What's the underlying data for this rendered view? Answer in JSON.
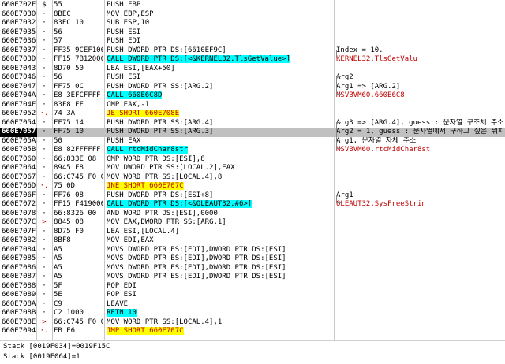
{
  "rows": [
    {
      "addr": "660E702F",
      "arrow": "$",
      "bytes": "55",
      "instr": "PUSH EBP",
      "hl": "",
      "comment": "",
      "ctype": ""
    },
    {
      "addr": "660E7030",
      "arrow": "·",
      "bytes": "8BEC",
      "instr": "MOV EBP,ESP",
      "hl": "",
      "comment": "",
      "ctype": ""
    },
    {
      "addr": "660E7032",
      "arrow": "·",
      "bytes": "83EC 10",
      "instr": "SUB ESP,10",
      "hl": "",
      "comment": "",
      "ctype": ""
    },
    {
      "addr": "660E7035",
      "arrow": "·",
      "bytes": "56",
      "instr": "PUSH ESI",
      "hl": "",
      "comment": "",
      "ctype": ""
    },
    {
      "addr": "660E7036",
      "arrow": "·",
      "bytes": "57",
      "instr": "PUSH EDI",
      "hl": "",
      "comment": "",
      "ctype": ""
    },
    {
      "addr": "660E7037",
      "arrow": "·",
      "bytes": "FF35 9CEF1066",
      "instr": "PUSH DWORD PTR DS:[6610EF9C]",
      "hl": "",
      "comment": "Index = 10.",
      "ctype": "sub"
    },
    {
      "addr": "660E703D",
      "arrow": "·",
      "bytes": "FF15 7B120066",
      "instr": "CALL DWORD PTR DS:[<&KERNEL32.TlsGetValue>]",
      "hl": "cyan",
      "comment": "KERNEL32.TlsGetValu",
      "ctype": "red"
    },
    {
      "addr": "660E7043",
      "arrow": "·",
      "bytes": "8D70 50",
      "instr": "LEA ESI,[EAX+50]",
      "hl": "",
      "comment": "",
      "ctype": ""
    },
    {
      "addr": "660E7046",
      "arrow": "·",
      "bytes": "56",
      "instr": "PUSH ESI",
      "hl": "",
      "comment": "Arg2",
      "ctype": "sub"
    },
    {
      "addr": "660E7047",
      "arrow": "·",
      "bytes": "FF75 0C",
      "instr": "PUSH DWORD PTR SS:[ARG.2]",
      "hl": "",
      "comment": "Arg1 => [ARG.2]",
      "ctype": "sub"
    },
    {
      "addr": "660E704A",
      "arrow": "·",
      "bytes": "E8 3EFCFFFF",
      "instr": "CALL 660E6C8D",
      "hl": "cyan",
      "comment": "MSVBVM60.660E6C8",
      "ctype": "red"
    },
    {
      "addr": "660E704F",
      "arrow": "·",
      "bytes": "83F8 FF",
      "instr": "CMP EAX,-1",
      "hl": "",
      "comment": "",
      "ctype": ""
    },
    {
      "addr": "660E7052",
      "arrow": "·.",
      "bytes": "74 3A",
      "instr": "JE SHORT 660E708E",
      "hl": "yellow",
      "comment": "",
      "ctype": ""
    },
    {
      "addr": "660E7054",
      "arrow": "·",
      "bytes": "FF75 14",
      "instr": "PUSH DWORD PTR SS:[ARG.4]",
      "hl": "",
      "comment": "Arg3 => [ARG.4], guess : 문자열 구조체 주소",
      "ctype": "sub"
    },
    {
      "addr": "660E7057",
      "arrow": "·",
      "bytes": "FF75 10",
      "instr": "PUSH DWORD PTR SS:[ARG.3]",
      "hl": "",
      "comment": "Arg2 = 1, guess : 문자열에서 구하고 싶은 위치",
      "ctype": "sub"
    },
    {
      "addr": "660E705A",
      "arrow": "·",
      "bytes": "50",
      "instr": "PUSH EAX",
      "hl": "",
      "comment": "Arg1, 문자열 자체 주소",
      "ctype": "sub"
    },
    {
      "addr": "660E705B",
      "arrow": "·",
      "bytes": "E8 82FFFFFF",
      "instr": "CALL rtcMidChar8str",
      "hl": "cyan",
      "comment": "MSVBVM60.rtcMidChar8st",
      "ctype": "red"
    },
    {
      "addr": "660E7060",
      "arrow": "·",
      "bytes": "66:833E 08",
      "instr": "CMP WORD PTR DS:[ESI],8",
      "hl": "",
      "comment": "",
      "ctype": ""
    },
    {
      "addr": "660E7064",
      "arrow": "·",
      "bytes": "8945 F8",
      "instr": "MOV DWORD PTR SS:[LOCAL.2],EAX",
      "hl": "",
      "comment": "",
      "ctype": ""
    },
    {
      "addr": "660E7067",
      "arrow": "·",
      "bytes": "66:C745 F0 08",
      "instr": "MOV WORD PTR SS:[LOCAL.4],8",
      "hl": "",
      "comment": "",
      "ctype": ""
    },
    {
      "addr": "660E706D",
      "arrow": "·.",
      "bytes": "75 0D",
      "instr": "JNE SHORT 660E707C",
      "hl": "yellow",
      "comment": "",
      "ctype": ""
    },
    {
      "addr": "660E706F",
      "arrow": "·",
      "bytes": "FF76 08",
      "instr": "PUSH DWORD PTR DS:[ESI+8]",
      "hl": "",
      "comment": "Arg1",
      "ctype": "sub"
    },
    {
      "addr": "660E7072",
      "arrow": "·",
      "bytes": "FF15 F4190066",
      "instr": "CALL DWORD PTR DS:[<&OLEAUT32.#6>]",
      "hl": "cyan",
      "comment": "OLEAUT32.SysFreeStrin",
      "ctype": "red"
    },
    {
      "addr": "660E7078",
      "arrow": "·",
      "bytes": "66:8326 00",
      "instr": "AND WORD PTR DS:[ESI],0000",
      "hl": "",
      "comment": "",
      "ctype": ""
    },
    {
      "addr": "660E707C",
      "arrow": ">",
      "bytes": "8845 08",
      "instr": "MOV EAX,DWORD PTR SS:[ARG.1]",
      "hl": "",
      "comment": "",
      "ctype": ""
    },
    {
      "addr": "660E707F",
      "arrow": "·",
      "bytes": "8D75 F0",
      "instr": "LEA ESI,[LOCAL.4]",
      "hl": "",
      "comment": "",
      "ctype": ""
    },
    {
      "addr": "660E7082",
      "arrow": "·",
      "bytes": "8BF8",
      "instr": "MOV EDI,EAX",
      "hl": "",
      "comment": "",
      "ctype": ""
    },
    {
      "addr": "660E7084",
      "arrow": "·",
      "bytes": "A5",
      "instr": "MOVS DWORD PTR ES:[EDI],DWORD PTR DS:[ESI]",
      "hl": "",
      "comment": "",
      "ctype": ""
    },
    {
      "addr": "660E7085",
      "arrow": "·",
      "bytes": "A5",
      "instr": "MOVS DWORD PTR ES:[EDI],DWORD PTR DS:[ESI]",
      "hl": "",
      "comment": "",
      "ctype": ""
    },
    {
      "addr": "660E7086",
      "arrow": "·",
      "bytes": "A5",
      "instr": "MOVS DWORD PTR ES:[EDI],DWORD PTR DS:[ESI]",
      "hl": "",
      "comment": "",
      "ctype": ""
    },
    {
      "addr": "660E7087",
      "arrow": "·",
      "bytes": "A5",
      "instr": "MOVS DWORD PTR ES:[EDI],DWORD PTR DS:[ESI]",
      "hl": "",
      "comment": "",
      "ctype": ""
    },
    {
      "addr": "660E7088",
      "arrow": "·",
      "bytes": "5F",
      "instr": "POP EDI",
      "hl": "",
      "comment": "",
      "ctype": ""
    },
    {
      "addr": "660E7089",
      "arrow": "·",
      "bytes": "5E",
      "instr": "POP ESI",
      "hl": "",
      "comment": "",
      "ctype": ""
    },
    {
      "addr": "660E708A",
      "arrow": "·",
      "bytes": "C9",
      "instr": "LEAVE",
      "hl": "",
      "comment": "",
      "ctype": ""
    },
    {
      "addr": "660E708B",
      "arrow": "·",
      "bytes": "C2 1000",
      "instr": "RETN 10",
      "hl": "cyan",
      "comment": "",
      "ctype": ""
    },
    {
      "addr": "660E708E",
      "arrow": ">",
      "bytes": "66:C745 F0 01",
      "instr": "MOV WORD PTR SS:[LOCAL.4],1",
      "hl": "",
      "comment": "",
      "ctype": ""
    },
    {
      "addr": "660E7094",
      "arrow": "·.",
      "bytes": "EB E6",
      "instr": "JMP SHORT 660E707C",
      "hl": "yellow",
      "comment": "",
      "ctype": ""
    }
  ],
  "selected_row": 14,
  "stack_info": [
    "Stack [0019F034]=0019F15C",
    "Stack [0019F064]=1"
  ],
  "colors": {
    "cyan_highlight": "#00ffff",
    "yellow_highlight": "#ffff00",
    "comment_red": "#c00000",
    "selected_row": "#c0c0c0"
  }
}
